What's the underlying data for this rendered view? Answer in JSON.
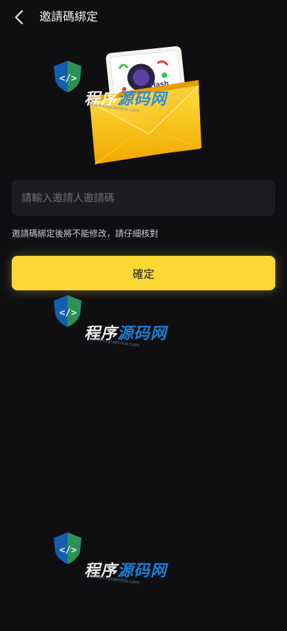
{
  "header": {
    "title": "邀請碼綁定",
    "back_icon": "chevron-left-icon"
  },
  "hero": {
    "icon": "envelope-icon",
    "card_text": "Hash"
  },
  "form": {
    "invite_placeholder": "請輸入邀請人邀請碼",
    "invite_value": "",
    "hint": "邀請碼綁定後將不能修改，請仔細核對",
    "confirm_label": "確定"
  },
  "watermark": {
    "text_part1": "程序",
    "text_part2": "源码网",
    "url": "www.cxyuanma.com"
  },
  "colors": {
    "background": "#0f0f12",
    "accent": "#fdd835",
    "input_bg": "#1c1c22"
  }
}
